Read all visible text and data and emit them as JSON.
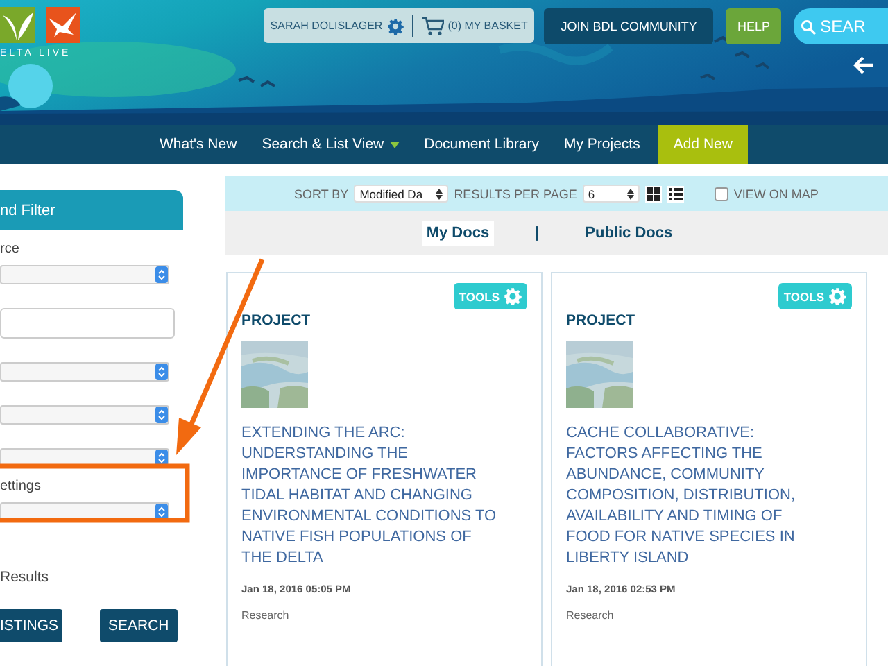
{
  "header": {
    "logo_text": "ELTA LIVE",
    "user": "SARAH DOLISLAGER",
    "basket": "(0) MY BASKET",
    "join": "JOIN BDL COMMUNITY",
    "help": "HELP",
    "search": "SEAR"
  },
  "nav": [
    {
      "label": "What's New",
      "kind": "link"
    },
    {
      "label": "Search & List View",
      "kind": "dropdown"
    },
    {
      "label": "Document Library",
      "kind": "link"
    },
    {
      "label": "My Projects",
      "kind": "link"
    },
    {
      "label": "Add New",
      "kind": "action"
    }
  ],
  "sidebar": {
    "title": "nd Filter",
    "fields": [
      {
        "kind": "select",
        "label": "rce"
      },
      {
        "kind": "input"
      },
      {
        "kind": "select"
      },
      {
        "kind": "select"
      },
      {
        "kind": "select"
      },
      {
        "kind": "select",
        "label": "ettings"
      }
    ],
    "results_label": "Results",
    "buttons": [
      "ISTINGS",
      "SEARCH"
    ]
  },
  "toolbar": {
    "sort_label": "SORT BY",
    "sort_value": "Modified Da",
    "per_page_label": "RESULTS PER PAGE",
    "per_page_value": "6",
    "map_label": "VIEW ON MAP",
    "map_checked": false
  },
  "doc_tabs": [
    {
      "label": "My Docs",
      "selected": true
    },
    {
      "label": "Public Docs",
      "selected": false
    }
  ],
  "doc_tab_separator": "|",
  "cards": [
    {
      "tools": "TOOLS",
      "type": "PROJECT",
      "title": "EXTENDING THE ARC: UNDERSTANDING THE IMPORTANCE OF FRESHWATER TIDAL HABITAT AND CHANGING ENVIRONMENTAL CONDITIONS TO NATIVE FISH POPULATIONS OF THE DELTA",
      "date": "Jan 18, 2016 05:05 PM",
      "category": "Research"
    },
    {
      "tools": "TOOLS",
      "type": "PROJECT",
      "title": "CACHE COLLABORATIVE: FACTORS AFFECTING THE ABUNDANCE, COMMUNITY COMPOSITION, DISTRIBUTION, AVAILABILITY AND TIMING OF FOOD FOR NATIVE SPECIES IN LIBERTY ISLAND",
      "date": "Jan 18, 2016 02:53 PM",
      "category": "Research"
    }
  ]
}
